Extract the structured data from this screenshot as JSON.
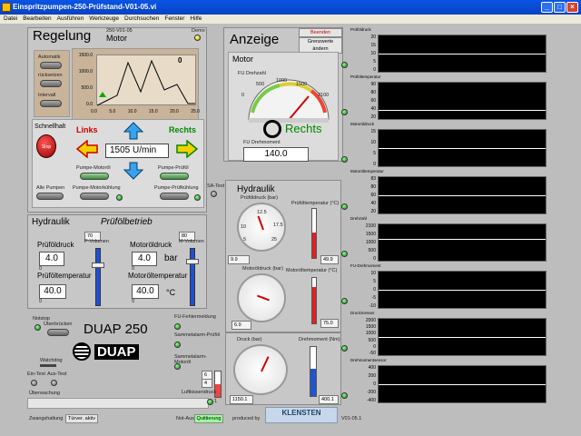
{
  "window": {
    "title": "Einspritzpumpen-250-Prüfstand-V01-05.vi",
    "min": "_",
    "max": "□",
    "close": "×"
  },
  "menu": [
    "Datei",
    "Bearbeiten",
    "Ausführen",
    "Werkzeuge",
    "Durchsuchen",
    "Fenster",
    "Hilfe"
  ],
  "regelung": {
    "title": "Regelung",
    "motor": "Motor",
    "version": "250-V01-05",
    "demo": "Demo",
    "automatik": "Automatik",
    "ruecksetzen": "rücksetzen",
    "intervall": "Intervall",
    "graph_value": "0",
    "graph_y": [
      "1500.0",
      "1000.0",
      "500.0",
      "0.0"
    ],
    "graph_x": [
      "0.0",
      "5.0",
      "10.0",
      "15.0",
      "20.0",
      "25.0"
    ],
    "schnellhalt": "Schnellhalt",
    "stop_label": "Stop",
    "links": "Links",
    "rechts": "Rechts",
    "speed": "1505",
    "unit": "U/min",
    "pumpe_motoroel": "Pumpe-Motoröl",
    "pumpe_pruefoel": "Pumpe-Prüföl",
    "alle_pumpen": "Alle Pumpen",
    "pumpe_motorkuehlung": "Pumpe-Motorkühlung",
    "pumpe_pruefkuehlung": "Pumpe-Prüfkühlung"
  },
  "hydraulik_left": {
    "title": "Hydraulik",
    "subtitle": "Prüfölbetrieb",
    "p_volumen": "P-Volumen",
    "m_volumen": "M-Volumen",
    "p_vol_val": "70",
    "m_vol_val": "80",
    "pruefoeldruck": "Prüföldruck",
    "pruefoeldruck_val": "4.0",
    "pruefoeltemp": "Prüföltemperatur",
    "pruefoeltemp_val": "40.0",
    "motoroeldruck": "Motoröldruck",
    "motoroeldruck_val": "4.0",
    "motoroeltemp": "Motoröltemperatur",
    "motoroeltemp_val": "40.0",
    "bar": "bar",
    "celsius": "°C",
    "zero": "0"
  },
  "bottom_left": {
    "notstop": "Notstop",
    "ueberbruecken": "Überbrücken",
    "duap": "DUAP 250",
    "watchdog": "Watchdog",
    "ein_test": "Ein-Test",
    "aus_test": "Aus-Test",
    "ueberwachung": "Überwachung",
    "zwangshaltung": "Zwangshaltung",
    "tuerver": "Türver. aktiv",
    "fu_fehler": "FU-Fehlermeldung",
    "sammel_pruef": "Sammelalarm-Prüföl",
    "sammel_motor": "Sammelalarm-Motoröl",
    "luftkissen": "Luftkissendruck",
    "lk_a": "6",
    "lk_b": "4",
    "lk_c": "1",
    "not_aus": "Not-Aus",
    "quittierung": "Quittierung",
    "produced": "produced by",
    "brand": "KLENSTEN",
    "version": "V01-05.1"
  },
  "anzeige": {
    "title": "Anzeige",
    "beenden": "Beenden",
    "grenzwerte": "Grenzwerte ändern",
    "motor": "Motor",
    "fu_drehzahl": "FU Drehzahl",
    "gauge_ticks": [
      "0",
      "500",
      "1000",
      "1500",
      "2100"
    ],
    "rechts": "Rechts",
    "fu_drehmoment": "FU Drehmoment",
    "drehmoment_val": "140.0"
  },
  "hydraulik_right": {
    "title": "Hydraulik",
    "satest": "SA-Test",
    "pruefoeldruck_bar": "Prüföldruck (bar)",
    "pruefoeltemp_c": "Prüföltemperatur (°C)",
    "pd_val": "9.9",
    "pt_val": "49.9",
    "motoroeldruck_bar": "Motoröldruck (bar)",
    "motoroeltemp_c": "Motoröltemperatur (°C)",
    "md_val": "6.9",
    "mt_val": "75.0",
    "druck_bar": "Druck (bar)",
    "drehmoment_nm": "Drehmoment (Nm)",
    "d_val": "1150.1",
    "dm_val": "400.1",
    "g1": [
      "2.5",
      "5",
      "7.5",
      "10",
      "12.5",
      "15",
      "17.5",
      "20",
      "22.5",
      "25"
    ],
    "t1": [
      "100",
      "80",
      "60",
      "40",
      "20",
      "0"
    ],
    "g3": [
      "200",
      "400",
      "600",
      "800",
      "1000",
      "1200",
      "1400",
      "1600",
      "1800",
      "2000"
    ],
    "t3": [
      "800",
      "700",
      "600",
      "500",
      "400",
      "300",
      "200",
      "100",
      "0"
    ]
  },
  "graphs": [
    {
      "title": "Prüföldruck",
      "ticks": [
        "20",
        "15",
        "10",
        "5",
        "0"
      ]
    },
    {
      "title": "Prüföltemperatur",
      "ticks": [
        "90",
        "80",
        "60",
        "40",
        "20"
      ]
    },
    {
      "title": "Motoröldruck",
      "ticks": [
        "15",
        "10",
        "5",
        "0"
      ]
    },
    {
      "title": "Motoröltemperatur",
      "ticks": [
        "83",
        "80",
        "60",
        "40",
        "20"
      ]
    },
    {
      "title": "Drehzahl",
      "ticks": [
        "2100",
        "1500",
        "1000",
        "500",
        "0"
      ]
    },
    {
      "title": "FU-Drehmoment",
      "ticks": [
        "10",
        "5",
        "0",
        "-5",
        "-10"
      ]
    },
    {
      "title": "Druckmesser",
      "ticks": [
        "2000",
        "1500",
        "1000",
        "500",
        "0",
        "-50"
      ]
    },
    {
      "title": "Drehmomentsensor",
      "ticks": [
        "400",
        "200",
        "0",
        "-200",
        "-400"
      ]
    }
  ]
}
